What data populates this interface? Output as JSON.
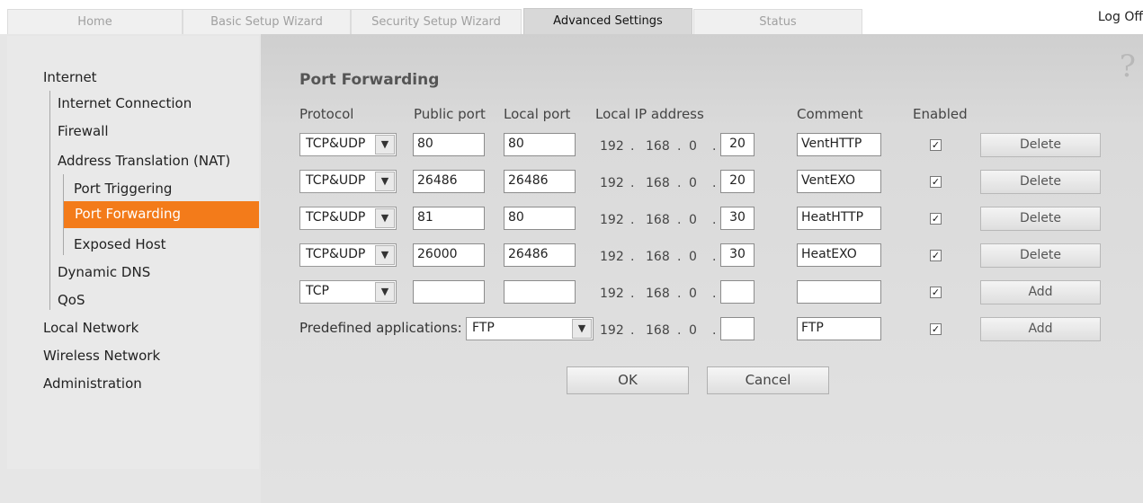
{
  "tabs": [
    "Home",
    "Basic Setup Wizard",
    "Security Setup Wizard",
    "Advanced Settings",
    "Status"
  ],
  "logoff": "Log Off",
  "help": "?",
  "nav": {
    "internet": "Internet",
    "internet_connection": "Internet Connection",
    "firewall": "Firewall",
    "nat": "Address Translation (NAT)",
    "port_triggering": "Port Triggering",
    "port_forwarding": "Port Forwarding",
    "exposed_host": "Exposed Host",
    "dynamic_dns": "Dynamic DNS",
    "qos": "QoS",
    "local_network": "Local Network",
    "wireless_network": "Wireless Network",
    "administration": "Administration"
  },
  "title": "Port Forwarding",
  "headers": {
    "protocol": "Protocol",
    "public_port": "Public port",
    "local_port": "Local port",
    "local_ip": "Local IP address",
    "comment": "Comment",
    "enabled": "Enabled"
  },
  "ip_prefix": [
    "192",
    ".",
    "168",
    ".",
    "0",
    "."
  ],
  "rows": [
    {
      "protocol": "TCP&UDP",
      "public_port": "80",
      "local_port": "80",
      "ip_last": "20",
      "comment": "VentHTTP",
      "enabled": "✓",
      "action": "Delete"
    },
    {
      "protocol": "TCP&UDP",
      "public_port": "26486",
      "local_port": "26486",
      "ip_last": "20",
      "comment": "VentEXO",
      "enabled": "✓",
      "action": "Delete"
    },
    {
      "protocol": "TCP&UDP",
      "public_port": "81",
      "local_port": "80",
      "ip_last": "30",
      "comment": "HeatHTTP",
      "enabled": "✓",
      "action": "Delete"
    },
    {
      "protocol": "TCP&UDP",
      "public_port": "26000",
      "local_port": "26486",
      "ip_last": "30",
      "comment": "HeatEXO",
      "enabled": "✓",
      "action": "Delete"
    },
    {
      "protocol": "TCP",
      "public_port": "",
      "local_port": "",
      "ip_last": "",
      "comment": "",
      "enabled": "✓",
      "action": "Add"
    }
  ],
  "predefined": {
    "label": "Predefined applications:",
    "app": "FTP",
    "ip_last": "",
    "comment": "FTP",
    "enabled": "✓",
    "action": "Add"
  },
  "ok": "OK",
  "cancel": "Cancel",
  "dropdown_arrow": "▼"
}
